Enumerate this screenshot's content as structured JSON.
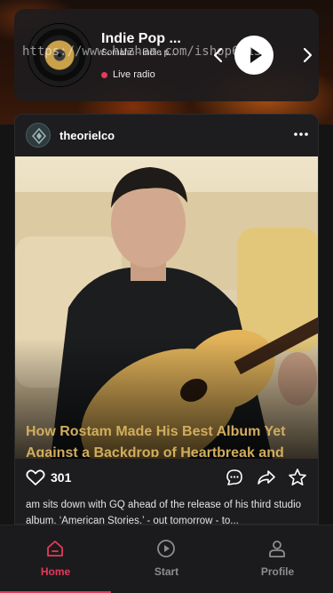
{
  "player": {
    "title": "Indie Pop ...",
    "subtitle": "Somafm - Indie p...",
    "live_label": "Live radio",
    "icons": {
      "prev": "chevron-left-icon",
      "play": "play-icon",
      "next": "chevron-right-icon"
    }
  },
  "watermark": "https://www.huzhan.com/ishop6113",
  "post": {
    "username": "theorielco",
    "headline": "How Rostam Made His Best Album Yet Against a Backdrop of Heartbreak and",
    "like_count": "301",
    "caption": "am sits down with GQ ahead of the release of his third studio album, ‘American Stories,’ - out tomorrow - to...",
    "icons": {
      "more": "more-horizontal-icon",
      "like": "heart-icon",
      "comment": "comment-icon",
      "share": "share-icon",
      "save": "star-icon"
    }
  },
  "tabs": [
    {
      "label": "Home",
      "icon": "home-icon",
      "active": true
    },
    {
      "label": "Start",
      "icon": "play-circle-icon",
      "active": false
    },
    {
      "label": "Profile",
      "icon": "user-icon",
      "active": false
    }
  ],
  "colors": {
    "accent": "#e63a5a",
    "headline": "#d2ad5c",
    "background": "#141414",
    "card": "#1d1d1f"
  }
}
